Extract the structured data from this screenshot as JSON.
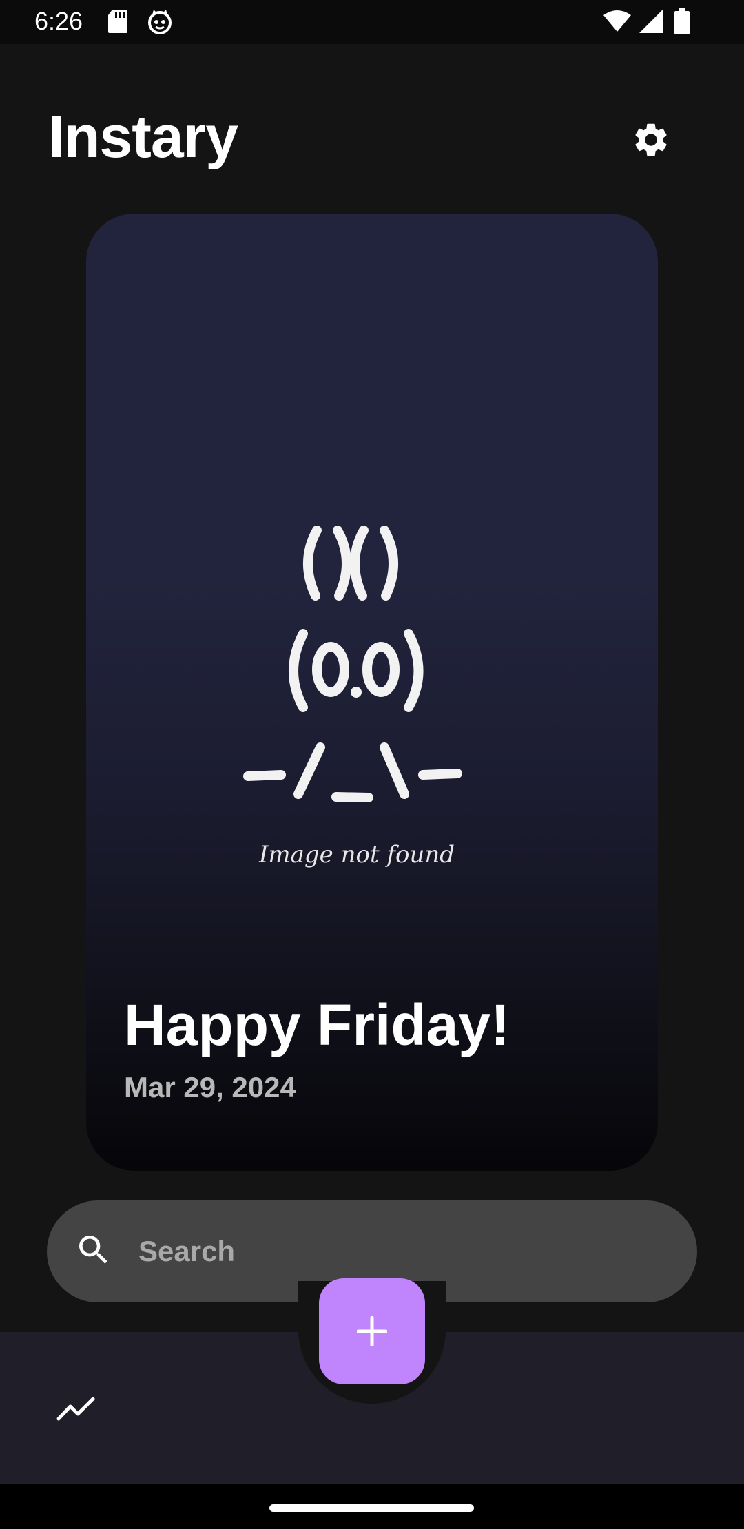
{
  "status_bar": {
    "time": "6:26",
    "icons": [
      "sd-card-icon",
      "cat-notification-icon",
      "wifi-icon",
      "signal-icon",
      "battery-icon"
    ]
  },
  "header": {
    "title": "Instary",
    "settings_icon": "gear-icon"
  },
  "entry_card": {
    "placeholder_caption": "Image not found",
    "title": "Happy Friday!",
    "date": "Mar 29, 2024"
  },
  "search": {
    "placeholder": "Search",
    "icon": "search-icon"
  },
  "bottom_bar": {
    "fab_icon": "plus-icon",
    "stats_icon": "trending-icon"
  },
  "colors": {
    "background": "#141414",
    "card_top": "#22243d",
    "accent": "#c084fc",
    "search_bg": "#444444",
    "bottom_bar": "#201e28"
  }
}
